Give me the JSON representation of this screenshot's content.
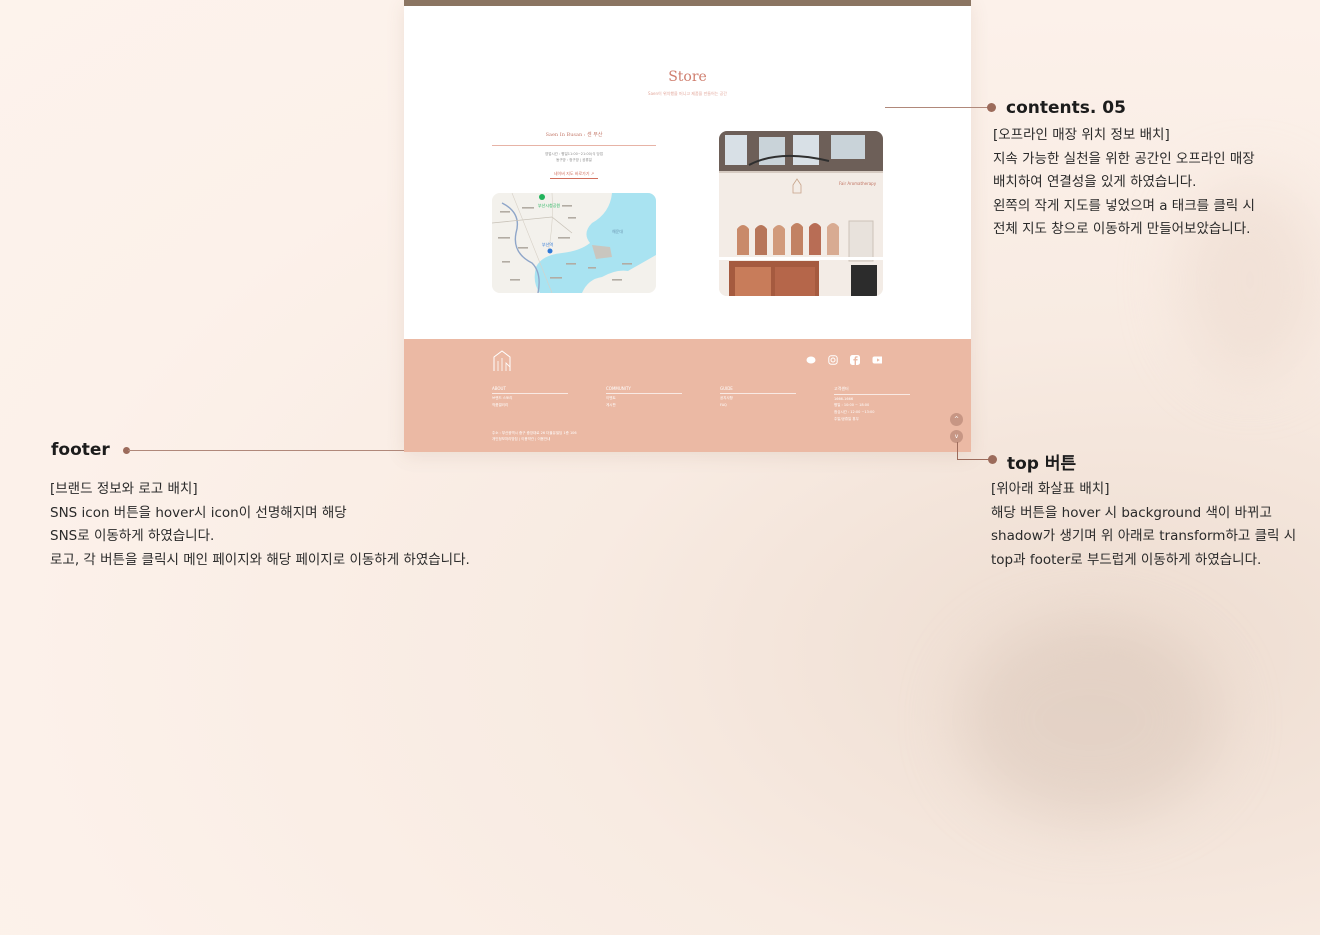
{
  "mockup": {
    "store_title": "Store",
    "store_subtitle": "Saen이 위치했을 머니고 제품을 만들어는 공간",
    "location_name": "Saen In Busan : 센 부산",
    "hours_line1": "영업시간 : 평일11:00~21:00(식 당업",
    "hours_line2": "동구방 : 정구방 | 공휴일",
    "map_link": "네이버 지도 바로가기 ↗",
    "map_labels": [
      "부산시청공원",
      "부산역",
      "해운대"
    ],
    "photo_sign": "Fair Aromatherapy",
    "footer": {
      "columns": [
        {
          "title": "ABOUT",
          "items": [
            "브랜드 스토리",
            "작품갤러리"
          ]
        },
        {
          "title": "COMMUNITY",
          "items": [
            "이벤트",
            "게시판"
          ]
        },
        {
          "title": "GUIDE",
          "items": [
            "공지사항",
            "FAQ"
          ]
        },
        {
          "title": "고객센터",
          "items": [
            "1666-1666",
            "평일 : 10:00 ~ 18:00",
            "점심시간 : 12:00 ~13:00",
            "주말/공휴일 휴무"
          ]
        }
      ],
      "address_line1": "주소 : 부산광역시 중구 중앙대로 26 더블유빌딩 1층 106",
      "address_line2": "개인정보처리방침 | 이용약관 | 이용안내",
      "sns": [
        "kakao-icon",
        "instagram-icon",
        "facebook-icon",
        "youtube-icon"
      ],
      "top_up": "^",
      "top_down": "v"
    }
  },
  "annotations": {
    "contents05": {
      "title": "contents. 05",
      "lines": [
        "[오프라인 매장 위치 정보 배치]",
        "지속 가능한 실천을 위한 공간인 오프라인 매장",
        "배치하여 연결성을 있게 하였습니다.",
        "왼쪽의 작게 지도를 넣었으며 a 태크를 클릭 시",
        "전체 지도 창으로 이동하게 만들어보았습니다."
      ]
    },
    "footer": {
      "title": "footer",
      "lines": [
        "[브랜드 정보와 로고 배치]",
        "SNS icon 버튼을 hover시 icon이 선명해지며 해당",
        "SNS로 이동하게 하였습니다.",
        "로고, 각 버튼을  클릭시 메인 페이지와 해당 페이지로 이동하게 하였습니다."
      ]
    },
    "top_button": {
      "title": "top 버튼",
      "lines": [
        "[위아래 화살표 배치]",
        "해당 버튼을 hover 시 background 색이 바뀌고",
        "shadow가 생기며 위 아래로 transform하고 클릭 시",
        "top과 footer로 부드럽게 이동하게 하였습니다."
      ]
    }
  },
  "colors": {
    "footer_bg": "#ebb9a4",
    "accent": "#cf7d6d",
    "annotation_dot": "#9c6b5b"
  }
}
